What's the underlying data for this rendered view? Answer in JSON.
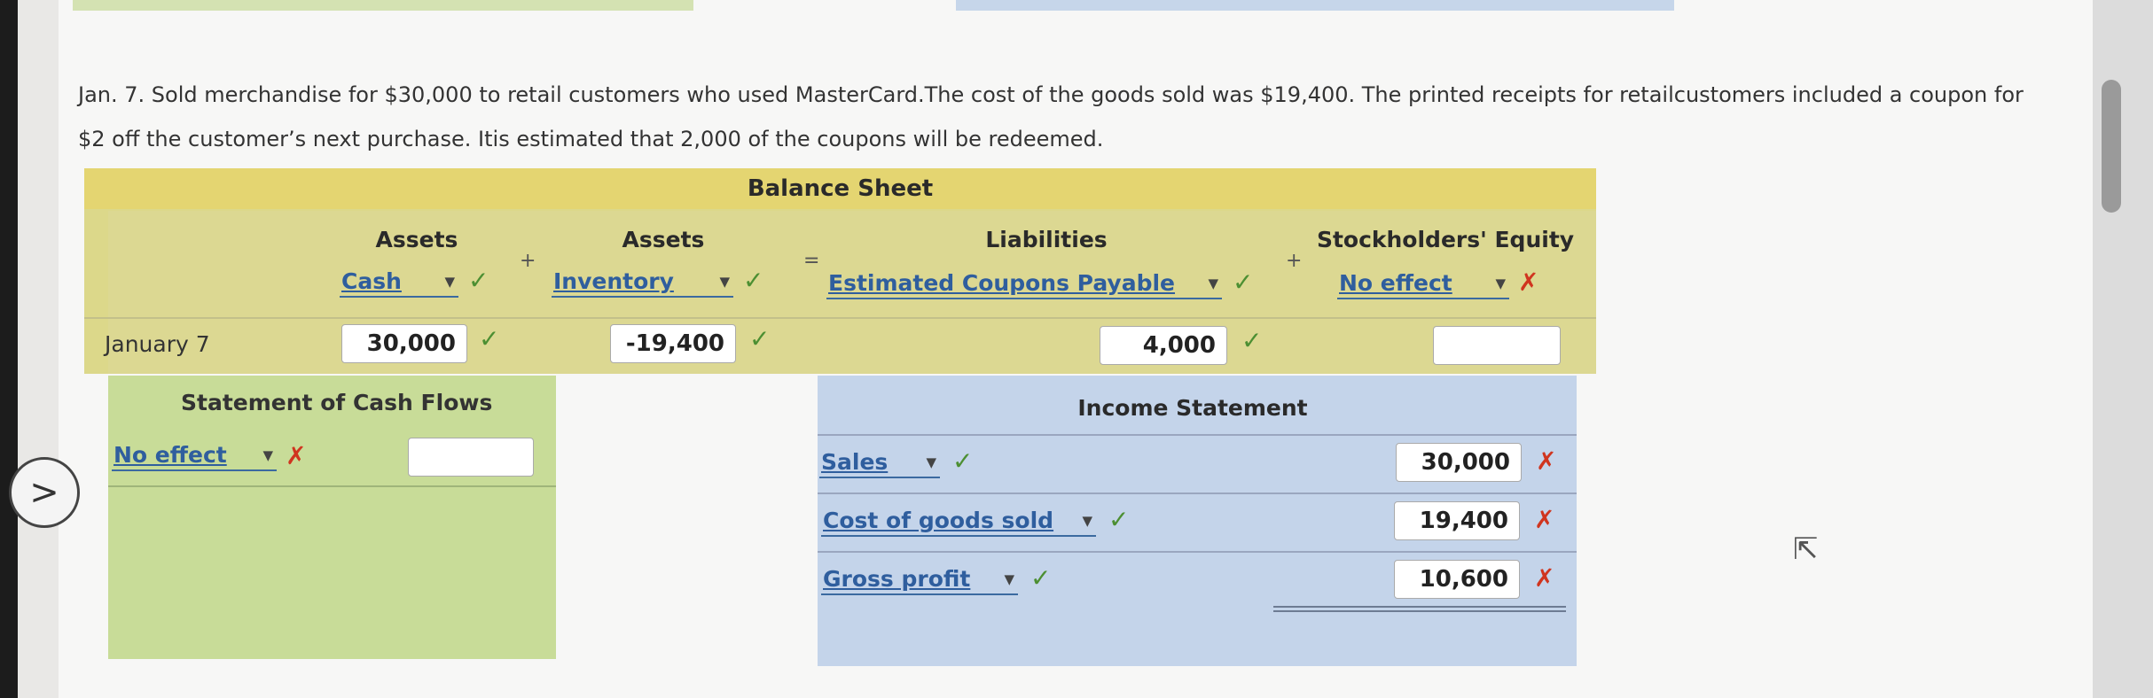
{
  "question": {
    "text_line1": "Jan. 7. Sold merchandise for $30,000 to retail customers who used MasterCard.The cost of the goods sold was $19,400. The printed receipts for retailcustomers included a coupon for",
    "text_line2": "$2 off the customer’s next purchase. Itis estimated that 2,000 of the coupons will be redeemed."
  },
  "balance_sheet": {
    "title": "Balance Sheet",
    "columns": [
      "Assets",
      "Assets",
      "Liabilities",
      "Stockholders' Equity"
    ],
    "operators": [
      "+",
      "=",
      "+"
    ],
    "accounts": [
      "Cash",
      "Inventory",
      "Estimated Coupons Payable",
      "No effect"
    ],
    "row_label": "January 7",
    "values": [
      "30,000",
      "-19,400",
      "4,000",
      ""
    ],
    "marks": [
      "✓",
      "✓",
      "✓",
      "✗"
    ],
    "value_marks": [
      "✓",
      "✓",
      "✓"
    ]
  },
  "cash_flows": {
    "title": "Statement of Cash Flows",
    "account": "No effect",
    "account_mark": "✗",
    "value": ""
  },
  "income_statement": {
    "title": "Income Statement",
    "rows": [
      {
        "account": "Sales",
        "account_mark": "✓",
        "value": "30,000",
        "value_mark": "✗"
      },
      {
        "account": "Cost of goods sold",
        "account_mark": "✓",
        "value": "19,400",
        "value_mark": "✗"
      },
      {
        "account": "Gross profit",
        "account_mark": "✓",
        "value": "10,600",
        "value_mark": "✗"
      }
    ]
  },
  "nav": {
    "next_glyph": ">"
  },
  "icons": [
    "chevron-right-icon",
    "dropdown-arrow-icon",
    "checkmark-icon",
    "cross-icon",
    "mouse-cursor-icon"
  ],
  "colors": {
    "correct": "#4c8f32",
    "incorrect": "#d0351f",
    "link": "#2f5e9e"
  }
}
